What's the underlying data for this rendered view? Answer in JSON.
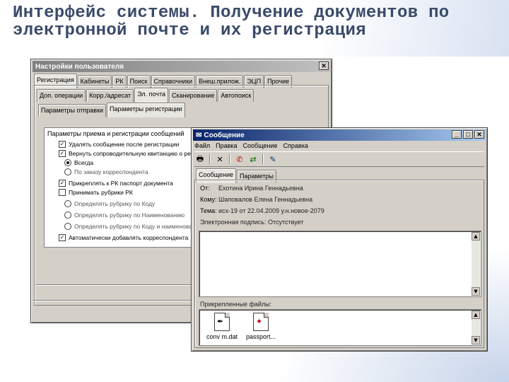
{
  "slide": {
    "title": "Интерфейс системы. Получение документов по электронной почте и их регистрация"
  },
  "settings_window": {
    "title": "Настройки пользователя",
    "tabs": [
      "Регистрация",
      "Кабинеты",
      "РК",
      "Поиск",
      "Справочники",
      "Внеш.прилож.",
      "ЭЦП",
      "Прочие"
    ],
    "subtabs": [
      "Доп. операции",
      "Корр./адресат",
      "Эл. почта",
      "Сканирование",
      "Автопоиск"
    ],
    "subsubtabs": [
      "Параметры отправки",
      "Параметры регистрации"
    ],
    "group_title": "Параметры приема и регистрации сообщений",
    "options": [
      {
        "type": "checkbox",
        "checked": true,
        "label": "Удалять сообщение после регистрации"
      },
      {
        "type": "checkbox",
        "checked": true,
        "label": "Вернуть сопроводительную квитанцию о регистрации"
      },
      {
        "type": "radio",
        "checked": true,
        "label": "Всегда"
      },
      {
        "type": "radio",
        "checked": false,
        "label": "По заказу корреспондента"
      },
      {
        "type": "checkbox",
        "checked": true,
        "label": "Прикреплять к РК паспорт документа"
      },
      {
        "type": "checkbox",
        "checked": false,
        "label": "Принимать рубрики РК"
      },
      {
        "type": "radio",
        "checked": false,
        "label": "Определять рубрику по Коду"
      },
      {
        "type": "radio",
        "checked": false,
        "label": "Определять рубрику по Наименованию"
      },
      {
        "type": "radio",
        "checked": false,
        "label": "Определять рубрику по Коду и наименованию"
      },
      {
        "type": "checkbox",
        "checked": true,
        "label": "Автоматически добавлять корреспондента"
      }
    ]
  },
  "message_window": {
    "title": "Сообщение",
    "menu": [
      "Файл",
      "Правка",
      "Сообщение",
      "Справка"
    ],
    "toolbar_icons": [
      "print-icon",
      "delete-icon",
      "reply-icon",
      "forward-icon",
      "register-icon"
    ],
    "tabs": [
      "Сообщение",
      "Параметры"
    ],
    "fields": [
      {
        "label": "От:",
        "value": "Ехотина Ирина Геннадьевна"
      },
      {
        "label": "Кому:",
        "value": "Шаповалов Елена Геннадьевна"
      },
      {
        "label": "Тема:",
        "value": "исх-19 от 22.04.2009 у.н.новое-2079"
      }
    ],
    "signature_text": "Электронная подпись: Отсутствует",
    "attachments_title": "Прикрепленные файлы:",
    "attachments": [
      "conv m.dat",
      "passport..."
    ]
  },
  "colors": {
    "title_text": "#3a4a6a",
    "active_titlebar": "#0a246a",
    "window_face": "#d4d0c8"
  }
}
